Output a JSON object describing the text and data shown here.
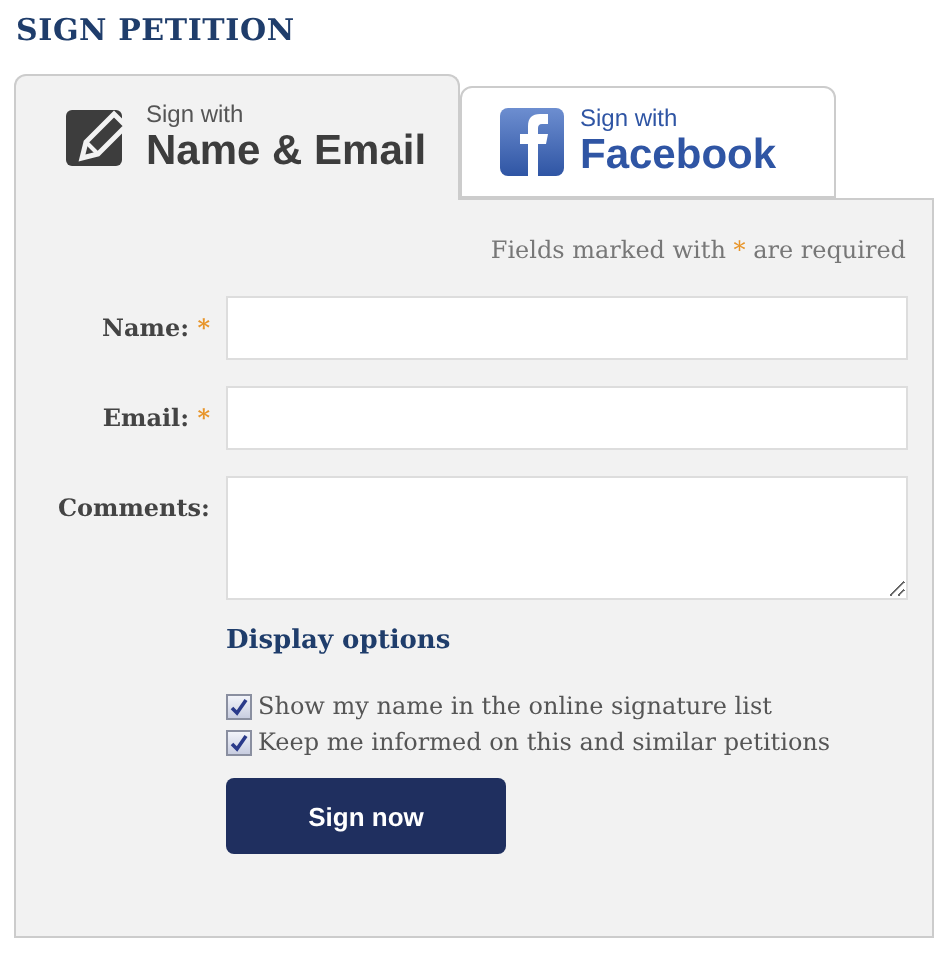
{
  "title": "SIGN PETITION",
  "tabs": [
    {
      "kind": "email",
      "small": "Sign with",
      "big": "Name & Email",
      "selected": true
    },
    {
      "kind": "facebook",
      "small": "Sign with",
      "big": "Facebook",
      "selected": false
    }
  ],
  "required_note": {
    "before": "Fields marked with",
    "mark": "*",
    "after": "are required"
  },
  "fields": [
    {
      "kind": "text",
      "label": "Name:",
      "mark": "*"
    },
    {
      "kind": "text",
      "label": "Email:",
      "mark": "*"
    },
    {
      "kind": "textarea",
      "label": "Comments:"
    }
  ],
  "display_options": "Display options",
  "options": [
    {
      "label": "Show my name in the online signature list",
      "checked": true
    },
    {
      "label": "Keep me informed on this and similar petitions",
      "checked": true
    }
  ],
  "submit": "Sign now"
}
